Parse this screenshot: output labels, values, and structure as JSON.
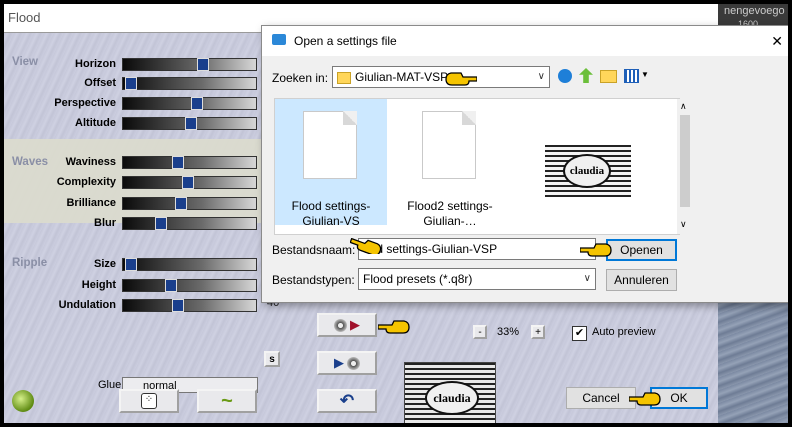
{
  "flood": {
    "title": "Flood",
    "sections": {
      "view": "View",
      "waves": "Waves",
      "ripple": "Ripple"
    },
    "view_params": [
      {
        "label": "Horizon",
        "level": 0.6
      },
      {
        "label": "Offset",
        "level": 0.02
      },
      {
        "label": "Perspective",
        "level": 0.55
      },
      {
        "label": "Altitude",
        "level": 0.5
      }
    ],
    "wave_params": [
      {
        "label": "Waviness",
        "level": 0.4
      },
      {
        "label": "Complexity",
        "level": 0.48
      },
      {
        "label": "Brilliance",
        "level": 0.42
      },
      {
        "label": "Blur",
        "level": 0.26
      }
    ],
    "ripple_params": [
      {
        "label": "Size",
        "level": 0.02
      },
      {
        "label": "Height",
        "level": 0.34
      },
      {
        "label": "Undulation",
        "level": 0.4,
        "value": "40"
      }
    ],
    "glue_label": "Glue",
    "glue_value": "normal",
    "glue_button": "s",
    "zoom": {
      "minus": "-",
      "value": "33%",
      "plus": "+"
    },
    "auto_preview_label": "Auto preview",
    "auto_preview_checked": true,
    "preview_logo": "claudia",
    "cancel_label": "Cancel",
    "ok_label": "OK",
    "corner_text": "nengevoego",
    "corner_text2": "1600"
  },
  "dialog": {
    "title": "Open a settings file",
    "close": "✕",
    "look_in_label": "Zoeken in:",
    "look_in_value": "Giulian-MAT-VSP",
    "files": [
      {
        "name": "Flood settings-Giulian-VS",
        "selected": true
      },
      {
        "name": "Flood2 settings-Giulian-…",
        "selected": false
      }
    ],
    "thumb_logo": "claudia",
    "filename_label": "Bestandsnaam:",
    "filename_value": "ood settings-Giulian-VSP",
    "filetype_label": "Bestandstypen:",
    "filetype_value": "Flood presets (*.q8r)",
    "open_label": "Openen",
    "cancel_label": "Annuleren"
  },
  "colors": {
    "accent": "#0078d7",
    "slider_thumb": "#1a3f8c",
    "pointer": "#f5c400"
  }
}
